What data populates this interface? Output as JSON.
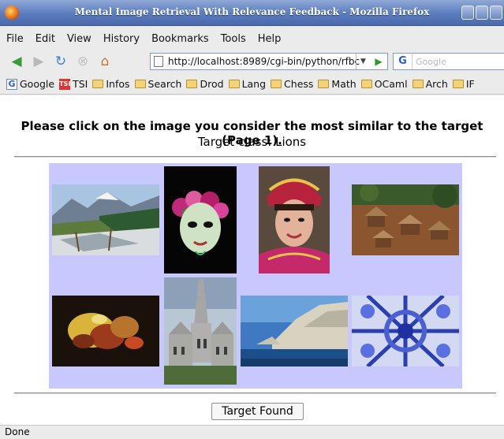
{
  "window": {
    "title": "Mental Image Retrieval With Relevance Feedback - Mozilla Firefox"
  },
  "menu": [
    "File",
    "Edit",
    "View",
    "History",
    "Bookmarks",
    "Tools",
    "Help"
  ],
  "navigation": {
    "url": "http://localhost:8989/cgi-bin/python/rfbc",
    "search_placeholder": "Google",
    "icons": [
      "back-icon",
      "forward-icon",
      "reload-icon",
      "stop-icon",
      "home-icon"
    ]
  },
  "bookmarks": [
    "Google",
    "TSI",
    "Infos",
    "Search",
    "Drod",
    "Lang",
    "Chess",
    "Math",
    "OCaml",
    "Arch",
    "IF"
  ],
  "page": {
    "heading": "Please click on the image you consider the most similar to the target (Page 1).",
    "subheading": "Target class: Lions",
    "images": [
      {
        "name": "mountain-river"
      },
      {
        "name": "carnival-mask"
      },
      {
        "name": "girl-traditional-costume"
      },
      {
        "name": "hillside-village"
      },
      {
        "name": "food-closeup"
      },
      {
        "name": "gothic-church"
      },
      {
        "name": "coastal-cliffs"
      },
      {
        "name": "blue-kaleidoscope"
      }
    ],
    "button_label": "Target Found"
  },
  "status": {
    "text": "Done"
  },
  "colors": {
    "panel": "#c8c8ff",
    "titlebar": "#5a7bbd"
  }
}
